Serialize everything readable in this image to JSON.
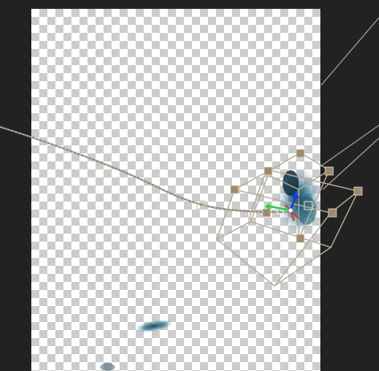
{
  "viewer": {
    "canvas_background": "#222222",
    "transparency_grid": {
      "light": "#ffffff",
      "dark": "#cccccc"
    },
    "colors": {
      "motion_path": "#a69a86",
      "camera_box": "#b6ab97",
      "handle_fill": "#9c8b6f",
      "axis_x": "#d93030",
      "axis_y": "#2ecc40",
      "axis_z": "#1e3ad8",
      "footage_tint": "#2d6f86"
    },
    "icons": {
      "camera": "camera-wireframe-icon",
      "gizmo": "transform-gizmo-icon",
      "keyframe": "keyframe-handle-icon"
    }
  }
}
